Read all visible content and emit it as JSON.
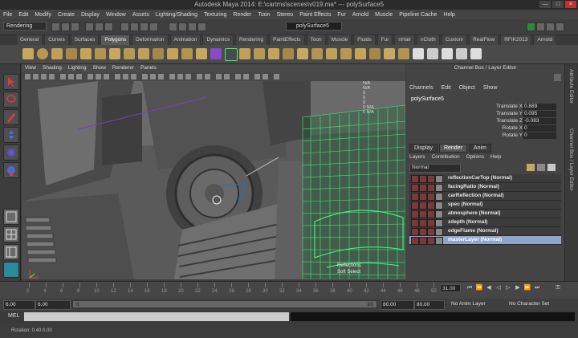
{
  "window": {
    "title": "Autodesk Maya 2014: E:\\cartms\\scenes\\v019.ma*   ---   polySurface5",
    "controls": [
      "—",
      "□",
      "✕"
    ]
  },
  "menubar": [
    "File",
    "Edit",
    "Modify",
    "Create",
    "Display",
    "Window",
    "Assets",
    "Lighting/Shading",
    "Texturing",
    "Render",
    "Toon",
    "Stereo",
    "Paint Effects",
    "Fur",
    "Arnold",
    "Muscle",
    "Pipeline Cache",
    "Help"
  ],
  "status_line": {
    "mode": "Rendering",
    "selection_field": "polySurface5"
  },
  "shelf_tabs": [
    "General",
    "Curves",
    "Surfaces",
    "Polygons",
    "Deformation",
    "Animation",
    "Dynamics",
    "Rendering",
    "PaintEffects",
    "Toon",
    "Muscle",
    "Fluids",
    "Fur",
    "nHair",
    "nCloth",
    "Custom",
    "RealFlow",
    "RFIK2013",
    "Arnold"
  ],
  "active_shelf_tab": "Polygons",
  "viewport": {
    "menu": [
      "View",
      "Shading",
      "Lighting",
      "Show",
      "Renderer",
      "Panels"
    ],
    "hud": [
      "Reflections",
      "Soft Select"
    ],
    "hud_values": [
      "N/A",
      "N/A",
      "0",
      "0",
      "0",
      "0 N/A",
      "0 N/A"
    ]
  },
  "channel_box": {
    "panel_title": "Channel Box / Layer Editor",
    "menu": [
      "Channels",
      "Edit",
      "Object",
      "Show"
    ],
    "object": "polySurface5",
    "attributes": [
      {
        "name": "Translate X",
        "value": "0.889"
      },
      {
        "name": "Translate Y",
        "value": "0.095"
      },
      {
        "name": "Translate Z",
        "value": "-0.083"
      },
      {
        "name": "Rotate X",
        "value": "0"
      },
      {
        "name": "Rotate Y",
        "value": "0"
      }
    ]
  },
  "layer_editor": {
    "tabs": [
      "Display",
      "Render",
      "Anim"
    ],
    "active_tab": "Render",
    "menu": [
      "Layers",
      "Contribution",
      "Options",
      "Help"
    ],
    "blend_mode": "Normal",
    "layers": [
      {
        "name": "reflectionCarTop (Normal)"
      },
      {
        "name": "facingRatio (Normal)"
      },
      {
        "name": "carReflection (Normal)"
      },
      {
        "name": "spec (Normal)"
      },
      {
        "name": "atmosphere (Normal)"
      },
      {
        "name": "zdepth (Normal)"
      },
      {
        "name": "edgeFlame (Normal)"
      },
      {
        "name": "masterLayer (Normal)"
      }
    ],
    "selected_layer": "masterLayer (Normal)"
  },
  "side_strip": [
    "Attribute Editor",
    "Channel Box / Layer Editor"
  ],
  "time_slider": {
    "ticks": [
      "2",
      "4",
      "6",
      "8",
      "10",
      "12",
      "14",
      "16",
      "18",
      "20",
      "22",
      "24",
      "26",
      "28",
      "30",
      "32",
      "34",
      "36",
      "38",
      "40",
      "42",
      "44",
      "46",
      "48",
      "50"
    ],
    "current_frame": "31.00"
  },
  "range_slider": {
    "start": "6.00",
    "anim_start": "6.00",
    "range_start": "6",
    "range_end": "80",
    "end": "80.00",
    "anim_end": "80.00",
    "anim_layer": "No Anim Layer",
    "character_set": "No Character Set"
  },
  "command_line": {
    "label": "MEL"
  },
  "help_line": {
    "text": "Rotation:   0.40   0.00"
  },
  "colors": {
    "wireframe": "#39f07a",
    "selected_layer": "#8fa6c8",
    "layer_swatch": "#7a3a3a"
  }
}
